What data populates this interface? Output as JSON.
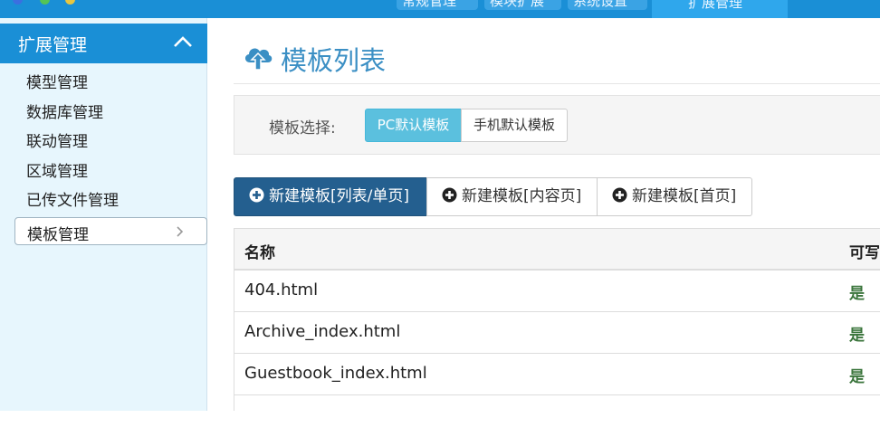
{
  "topbar": {
    "tabs": [
      {
        "label": "常规管理"
      },
      {
        "label": "模块扩展"
      },
      {
        "label": "系统设置"
      },
      {
        "label": "扩展管理"
      }
    ],
    "colors": {
      "bar": "#1a8fd6",
      "dot_blue": "#3b6fe0",
      "dot_green": "#55c455",
      "dot_yellow": "#e8c640"
    }
  },
  "sidebar": {
    "header": "扩展管理",
    "items": [
      {
        "label": "模型管理"
      },
      {
        "label": "数据库管理"
      },
      {
        "label": "联动管理"
      },
      {
        "label": "区域管理"
      },
      {
        "label": "已传文件管理"
      },
      {
        "label": "模板管理"
      }
    ],
    "active_index": 5
  },
  "page": {
    "title": "模板列表",
    "title_icon": "cloud-upload-icon"
  },
  "filter": {
    "label": "模板选择:",
    "options": [
      {
        "label": "PC默认模板",
        "selected": true
      },
      {
        "label": "手机默认模板",
        "selected": false
      }
    ]
  },
  "actions": [
    {
      "label": "新建模板[列表/单页]",
      "icon": "plus-circle-icon"
    },
    {
      "label": "新建模板[内容页]",
      "icon": "plus-circle-icon"
    },
    {
      "label": "新建模板[首页]",
      "icon": "plus-circle-icon"
    }
  ],
  "table": {
    "columns": [
      "名称",
      "可写"
    ],
    "rows": [
      {
        "name": "404.html",
        "writable": "是"
      },
      {
        "name": "Archive_index.html",
        "writable": "是"
      },
      {
        "name": "Guestbook_index.html",
        "writable": "是"
      }
    ]
  }
}
